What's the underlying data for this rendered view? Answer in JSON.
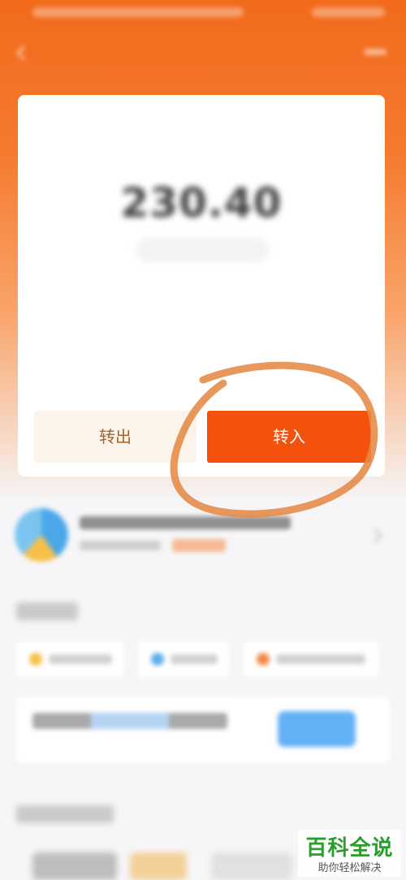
{
  "status_bar": {},
  "header": {
    "title": "",
    "subtitle": ""
  },
  "account_card": {
    "balance_label": "",
    "balance_amount": "230.40",
    "yield_pill": "",
    "stats": [
      {
        "label": "",
        "value": ""
      },
      {
        "label": "",
        "value": ""
      }
    ],
    "transfer_out_label": "转出",
    "transfer_in_label": "转入"
  },
  "annotation": {
    "color": "#e58a45"
  },
  "colors": {
    "brand_orange": "#f26a1c",
    "primary_button": "#f4500e",
    "secondary_button_bg": "#fcf3ea",
    "secondary_button_text": "#a06430"
  },
  "watermark": {
    "title": "百科全说",
    "subtitle": "助你轻松解决"
  }
}
